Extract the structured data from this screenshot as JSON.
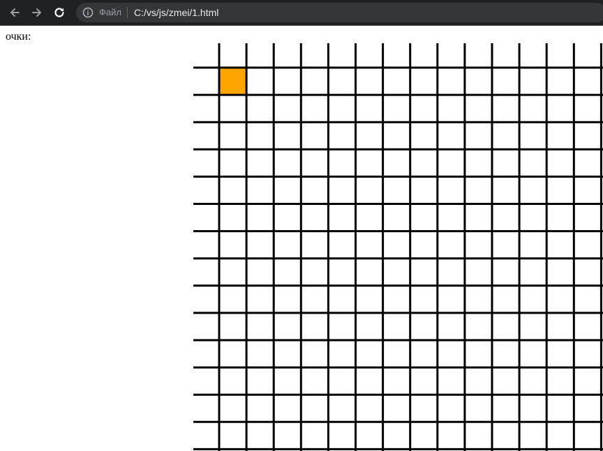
{
  "browser": {
    "file_label": "Файл",
    "url": "C:/vs/js/zmei/1.html",
    "icons": {
      "back": "arrow-left-icon",
      "forward": "arrow-right-icon",
      "reload": "reload-icon",
      "info": "info-icon"
    }
  },
  "page": {
    "score_label": "очки:"
  },
  "game": {
    "grid_color": "#000000",
    "cell_color": "#ffffff",
    "snake_color": "#ffa500",
    "snake_segments": [
      {
        "row": 1,
        "col": 1
      }
    ]
  }
}
